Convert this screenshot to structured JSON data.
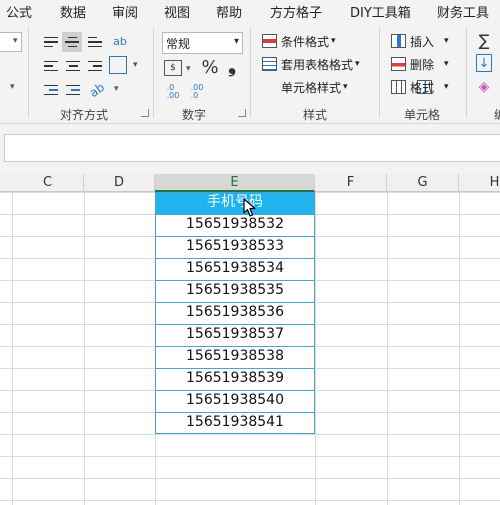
{
  "menu": [
    "公式",
    "数据",
    "审阅",
    "视图",
    "帮助",
    "方方格子",
    "DIY工具箱",
    "财务工具"
  ],
  "ribbon": {
    "groups": {
      "alignment": "对齐方式",
      "number": "数字",
      "styles": "样式",
      "cells": "单元格"
    },
    "number_format": "常规",
    "styles_buttons": [
      "条件格式",
      "套用表格格式",
      "单元格样式"
    ],
    "cells_buttons": [
      "插入",
      "删除",
      "格式"
    ],
    "glyphs": {
      "percent": "%",
      "comma": "❟",
      "wrap": "ab",
      "sigma": "∑",
      "down_fill": "↓",
      "eraser": "◈",
      "chevron": "⌄"
    },
    "truncated_group_label": "编"
  },
  "formula_bar": {
    "value": ""
  },
  "columns": [
    "C",
    "D",
    "E",
    "F",
    "G",
    "H"
  ],
  "selected_column": "E",
  "table": {
    "header": "手机号码",
    "rows": [
      "15651938532",
      "15651938533",
      "15651938534",
      "15651938535",
      "15651938536",
      "15651938537",
      "15651938538",
      "15651938539",
      "15651938540",
      "15651938541"
    ]
  },
  "colors": {
    "header_fill": "#1fb4ee",
    "table_border": "#4aa6c9",
    "selected_col_accent": "#217346"
  }
}
